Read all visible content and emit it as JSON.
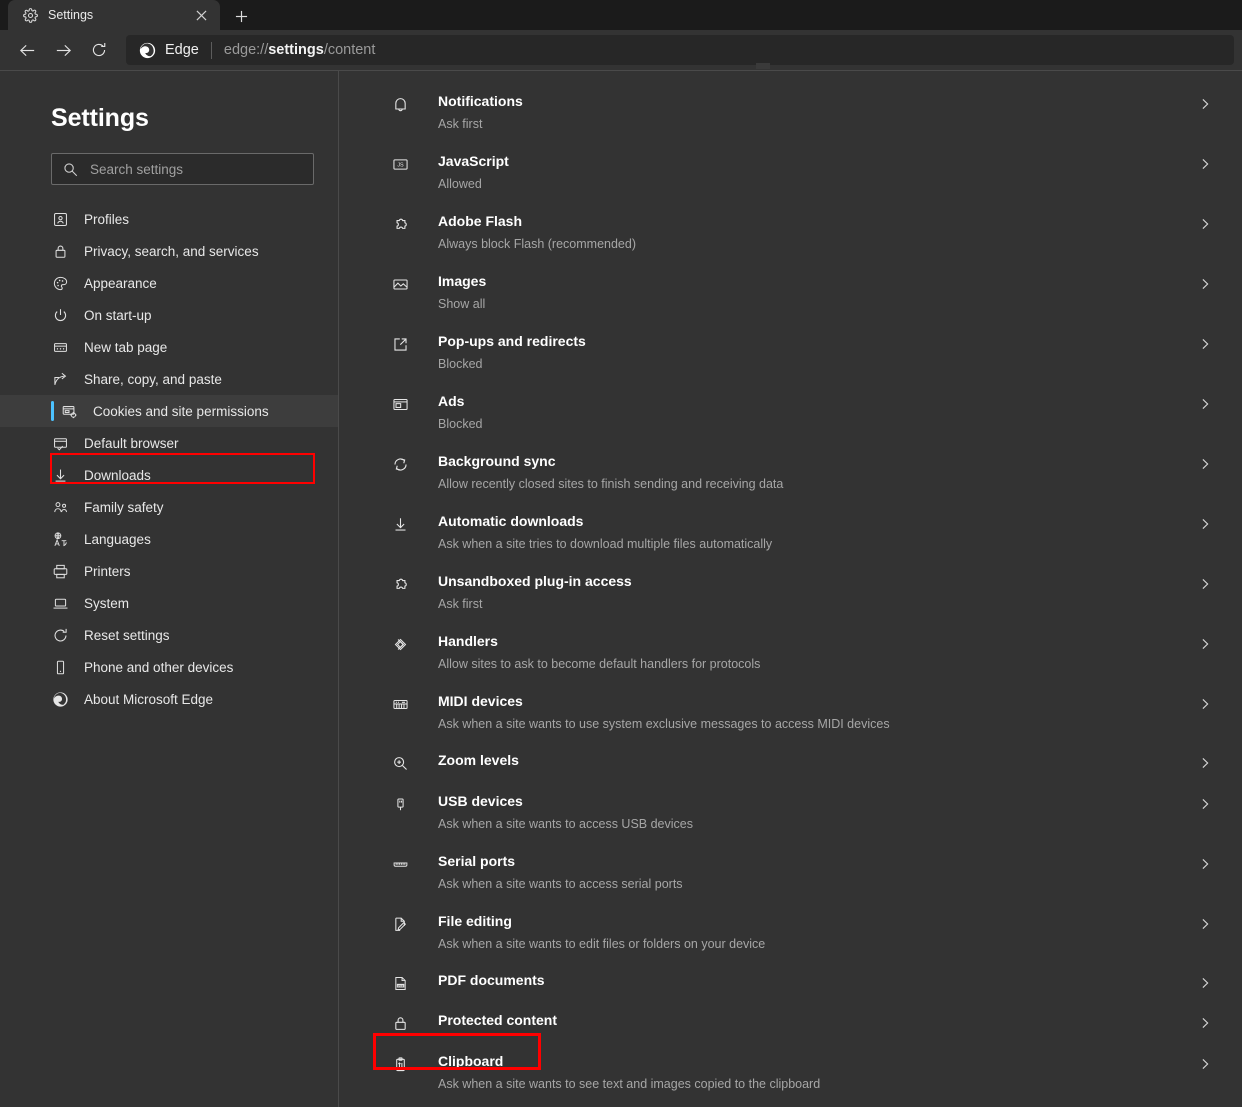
{
  "window": {
    "tab": {
      "title": "Settings",
      "favicon_icon": "gear-icon",
      "close_icon": "close-icon"
    },
    "newtab_icon": "plus-icon"
  },
  "toolbar": {
    "back_icon": "arrow-left-icon",
    "forward_icon": "arrow-right-icon",
    "reload_icon": "refresh-icon",
    "brand_label": "Edge",
    "brand_icon": "edge-logo-icon",
    "url_prefix": "edge://",
    "url_bold": "settings",
    "url_suffix": "/content",
    "url_full": "edge://settings/content"
  },
  "sidebar": {
    "title": "Settings",
    "search": {
      "placeholder": "Search settings",
      "value": "",
      "icon": "search-icon"
    },
    "accent_color": "#4cc2ff",
    "items": [
      {
        "label": "Profiles",
        "icon": "profile-card-icon",
        "selected": false
      },
      {
        "label": "Privacy, search, and services",
        "icon": "lock-icon",
        "selected": false
      },
      {
        "label": "Appearance",
        "icon": "palette-icon",
        "selected": false
      },
      {
        "label": "On start-up",
        "icon": "power-icon",
        "selected": false
      },
      {
        "label": "New tab page",
        "icon": "new-tab-page-icon",
        "selected": false
      },
      {
        "label": "Share, copy, and paste",
        "icon": "share-icon",
        "selected": false
      },
      {
        "label": "Cookies and site permissions",
        "icon": "cookies-permissions-icon",
        "selected": true
      },
      {
        "label": "Default browser",
        "icon": "default-browser-icon",
        "selected": false
      },
      {
        "label": "Downloads",
        "icon": "download-icon",
        "selected": false
      },
      {
        "label": "Family safety",
        "icon": "family-icon",
        "selected": false
      },
      {
        "label": "Languages",
        "icon": "languages-icon",
        "selected": false
      },
      {
        "label": "Printers",
        "icon": "printer-icon",
        "selected": false
      },
      {
        "label": "System",
        "icon": "laptop-icon",
        "selected": false
      },
      {
        "label": "Reset settings",
        "icon": "reset-icon",
        "selected": false
      },
      {
        "label": "Phone and other devices",
        "icon": "phone-icon",
        "selected": false
      },
      {
        "label": "About Microsoft Edge",
        "icon": "edge-logo-icon",
        "selected": false
      }
    ]
  },
  "content": {
    "chevron_icon": "chevron-right-icon",
    "rows": [
      {
        "title": "Notifications",
        "sub": "Ask first",
        "icon": "bell-icon"
      },
      {
        "title": "JavaScript",
        "sub": "Allowed",
        "icon": "javascript-icon"
      },
      {
        "title": "Adobe Flash",
        "sub": "Always block Flash (recommended)",
        "icon": "puzzle-icon"
      },
      {
        "title": "Images",
        "sub": "Show all",
        "icon": "image-icon"
      },
      {
        "title": "Pop-ups and redirects",
        "sub": "Blocked",
        "icon": "popup-icon"
      },
      {
        "title": "Ads",
        "sub": "Blocked",
        "icon": "ads-icon"
      },
      {
        "title": "Background sync",
        "sub": "Allow recently closed sites to finish sending and receiving data",
        "icon": "sync-icon"
      },
      {
        "title": "Automatic downloads",
        "sub": "Ask when a site tries to download multiple files automatically",
        "icon": "download-icon"
      },
      {
        "title": "Unsandboxed plug-in access",
        "sub": "Ask first",
        "icon": "puzzle-icon"
      },
      {
        "title": "Handlers",
        "sub": "Allow sites to ask to become default handlers for protocols",
        "icon": "handlers-icon"
      },
      {
        "title": "MIDI devices",
        "sub": "Ask when a site wants to use system exclusive messages to access MIDI devices",
        "icon": "midi-icon"
      },
      {
        "title": "Zoom levels",
        "sub": "",
        "icon": "zoom-in-icon"
      },
      {
        "title": "USB devices",
        "sub": "Ask when a site wants to access USB devices",
        "icon": "usb-icon"
      },
      {
        "title": "Serial ports",
        "sub": "Ask when a site wants to access serial ports",
        "icon": "serial-port-icon"
      },
      {
        "title": "File editing",
        "sub": "Ask when a site wants to edit files or folders on your device",
        "icon": "file-edit-icon"
      },
      {
        "title": "PDF documents",
        "sub": "",
        "icon": "pdf-icon"
      },
      {
        "title": "Protected content",
        "sub": "",
        "icon": "padlock-icon"
      },
      {
        "title": "Clipboard",
        "sub": "Ask when a site wants to see text and images copied to the clipboard",
        "icon": "clipboard-icon"
      }
    ]
  },
  "annotations": {
    "color": "#ff0000",
    "boxes": [
      {
        "target": "sidebar-item-cookies-and-site-permissions"
      },
      {
        "target": "content-row-pdf-documents"
      }
    ]
  }
}
